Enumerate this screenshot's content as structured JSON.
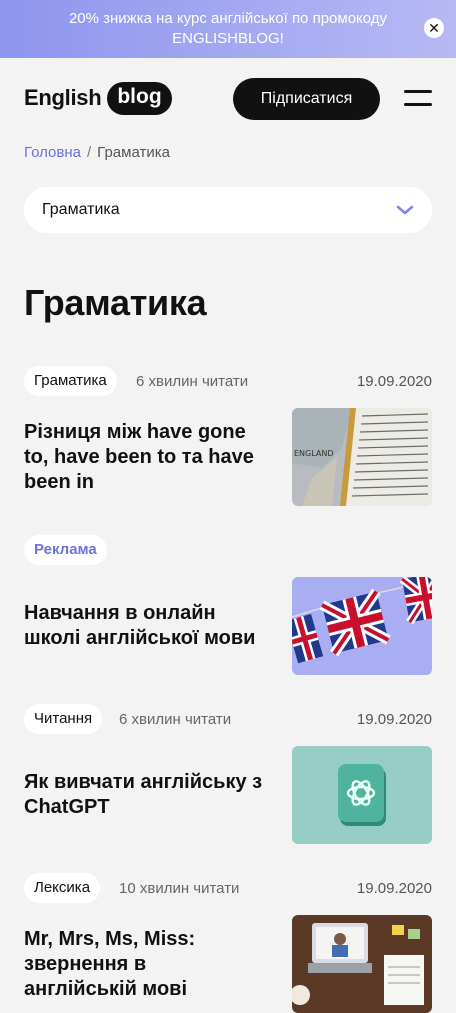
{
  "promo": {
    "text": "20% знижка на курс англійської по промокоду ENGLISHBLOG!",
    "close_icon": "close-icon"
  },
  "header": {
    "logo_word1": "English",
    "logo_word2": "blog",
    "subscribe_label": "Підписатися",
    "menu_icon": "hamburger-menu-icon"
  },
  "breadcrumb": {
    "home": "Головна",
    "separator": "/",
    "current": "Граматика"
  },
  "category_select": {
    "value": "Граматика",
    "icon": "chevron-down-icon"
  },
  "page_title": "Граматика",
  "articles": [
    {
      "tag": "Граматика",
      "read_time": "6 хвилин читати",
      "date": "19.09.2020",
      "title": "Різниця між have gone to, have been to та have been in",
      "image": "dictionary-map-image"
    },
    {
      "tag": "Реклама",
      "read_time": "",
      "date": "",
      "title": "Навчання в онлайн школі англійської мови",
      "image": "uk-flags-image"
    },
    {
      "tag": "Читання",
      "read_time": "6 хвилин читати",
      "date": "19.09.2020",
      "title": "Як вивчати англійську з ChatGPT",
      "image": "chatgpt-logo-image"
    },
    {
      "tag": "Лексика",
      "read_time": "10 хвилин читати",
      "date": "19.09.2020",
      "title": "Mr, Mrs, Ms, Miss: звернення в англійській мові",
      "image": "desk-laptop-image"
    }
  ],
  "colors": {
    "accent": "#6d73d9",
    "promo_from": "#8e95ee",
    "promo_to": "#b7b9f4",
    "background": "#f3f3f4",
    "dark": "#111111"
  }
}
